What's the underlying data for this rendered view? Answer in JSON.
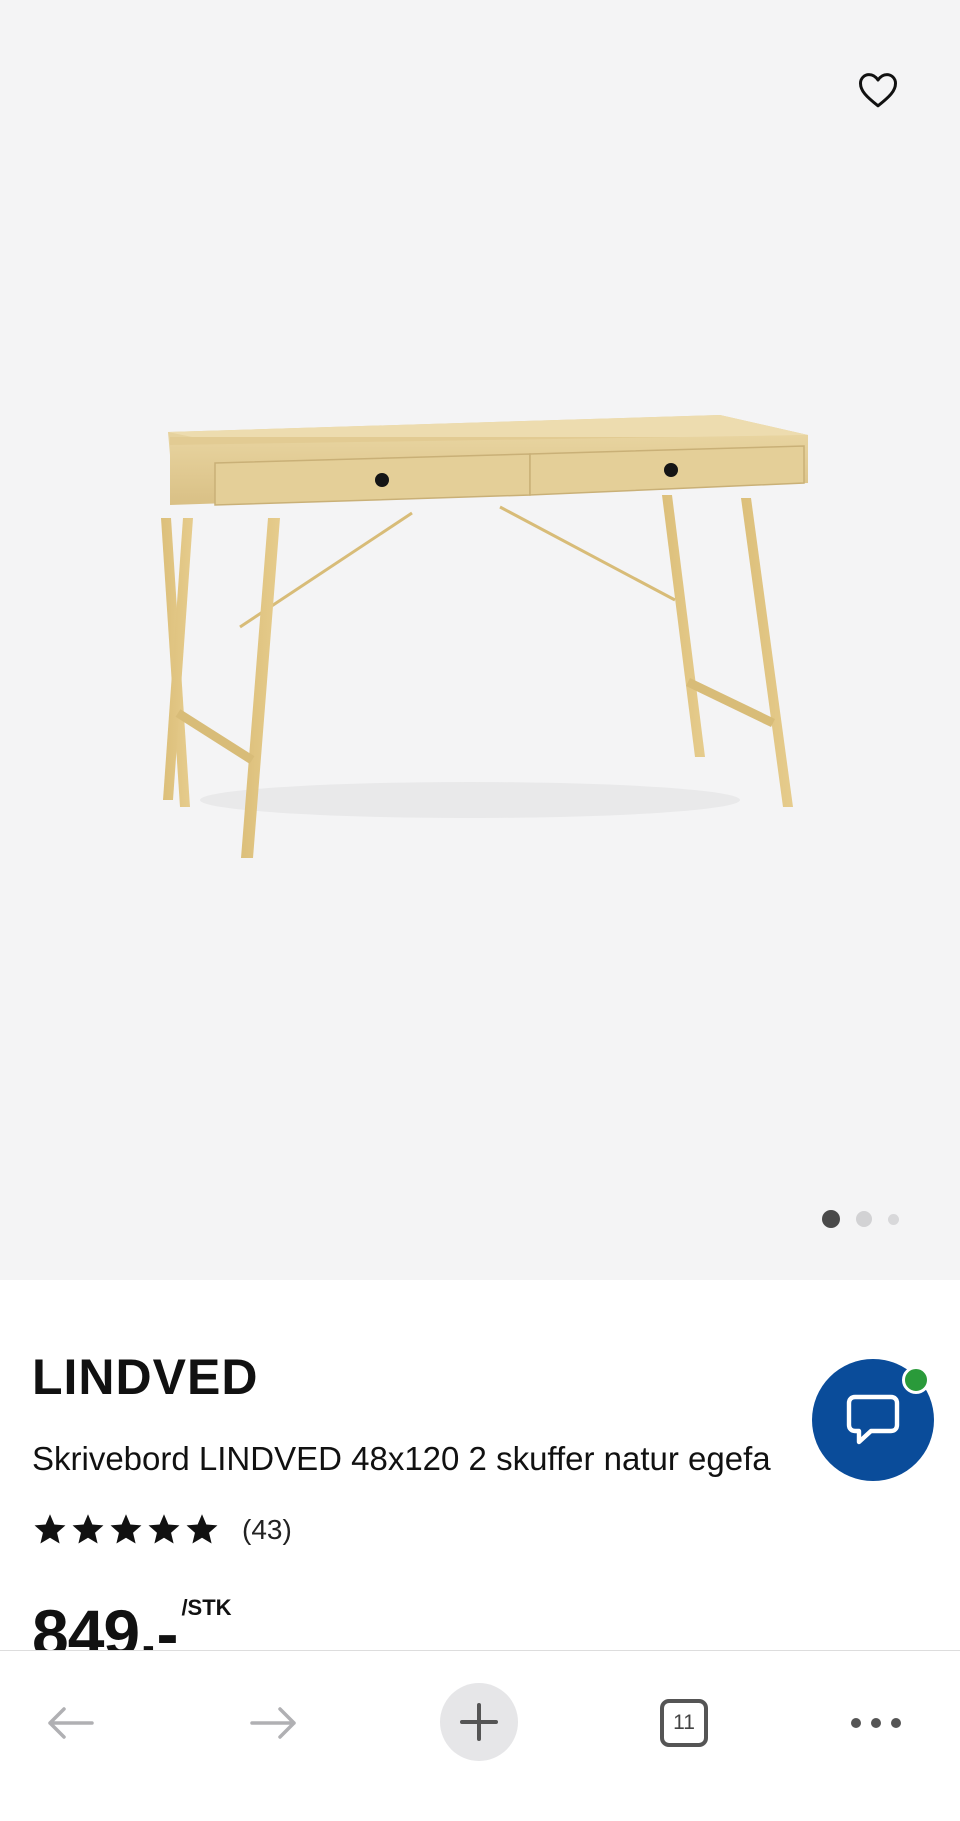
{
  "product": {
    "brand": "LINDVED",
    "name": "Skrivebord LINDVED 48x120 2 skuffer natur egefa",
    "review_count": "(43)",
    "rating": 5,
    "rating_max": 5,
    "price": "849,-",
    "unit": "/STK"
  },
  "gallery": {
    "image_count": 3,
    "active_index": 0
  },
  "browser": {
    "tab_count": "11"
  },
  "icons": {
    "favorite": "heart-outline-icon",
    "chat": "speech-bubble-icon",
    "back": "arrow-left-icon",
    "forward": "arrow-right-icon",
    "new_tab": "plus-icon",
    "more": "ellipsis-icon"
  },
  "colors": {
    "gallery_bg": "#f4f4f5",
    "chat_button": "#0a4c9a",
    "online_indicator": "#2a9a3a",
    "active_dot": "#4a4a4a"
  }
}
